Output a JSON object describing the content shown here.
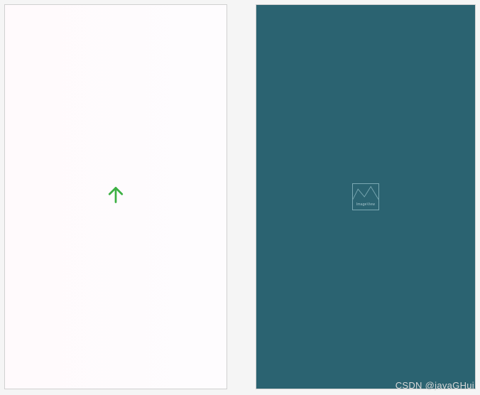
{
  "left_panel": {
    "icon_name": "arrow-up-icon",
    "icon_color": "#3cb043"
  },
  "right_panel": {
    "background": "#2b6371",
    "placeholder_label": "ImageView",
    "placeholder_border": "#7ba9b3"
  },
  "watermark": "CSDN @javaGHui"
}
